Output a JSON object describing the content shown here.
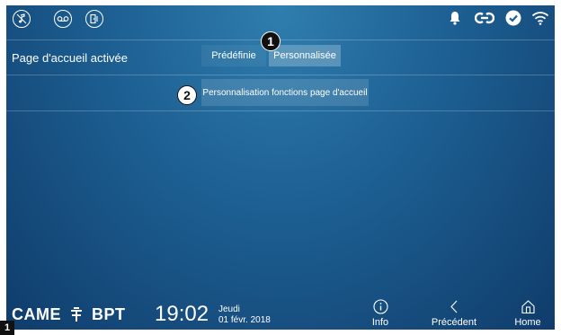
{
  "topbar": {
    "left_icons": [
      "music-off-icon",
      "voicemail-icon",
      "door-intercom-icon"
    ],
    "right_icons": [
      "bell-icon",
      "link-icon",
      "check-circle-icon",
      "wifi-icon"
    ]
  },
  "home_page_row": {
    "label": "Page d'accueil activée",
    "options": [
      "Prédéfinie",
      "Personnalisée"
    ],
    "selected": "Personnalisée"
  },
  "customize": {
    "label": "Personnalisation fonctions page d'accueil"
  },
  "callouts": [
    "1",
    "2"
  ],
  "figure_tag": "1",
  "bottombar": {
    "logo_left": "CAME",
    "logo_right": "BPT",
    "time": "19:02",
    "day": "Jeudi",
    "date": "01 févr. 2018",
    "nav": [
      {
        "label": "Info",
        "icon": "info-icon"
      },
      {
        "label": "Précédent",
        "icon": "back-icon"
      },
      {
        "label": "Home",
        "icon": "home-icon"
      }
    ]
  },
  "colors": {
    "background_top": "#2f7eae",
    "background_bottom": "#0f3c6b",
    "text": "#ffffff"
  }
}
